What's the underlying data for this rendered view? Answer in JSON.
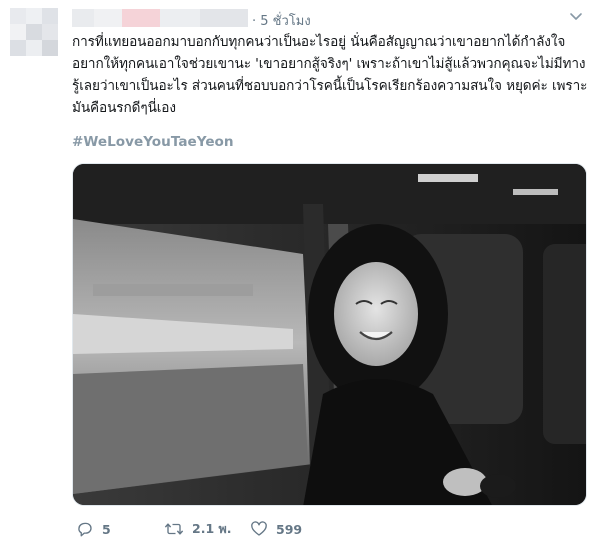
{
  "tweet": {
    "timestamp": "· 5 ชั่วโมง",
    "text_lines": [
      "การที่แทยอนออกมาบอกกับทุกคนว่าเป็นอะไรอยู่ นั่นคือสัญญาณว่าเขาอยากได้กำลังใจ",
      "อยากให้ทุกคนเอาใจช่วยเขานะ 'เขาอยากสู้จริงๆ' เพราะถ้าเขาไม่สู้แล้วพวกคุณจะไม่มีทาง",
      "รู้เลยว่าเขาเป็นอะไร ส่วนคนที่ชอบบอกว่าโรคนี้เป็นโรคเรียกร้องความสนใจ หยุดค่ะ เพราะ",
      "มันคือนรกดีๆนี่เอง"
    ],
    "hashtag": "#WeLoveYouTaeYeon",
    "replies": "5",
    "retweets": "2.1 พ.",
    "likes": "599"
  },
  "icons": {
    "reply": "reply-icon",
    "retweet": "retweet-icon",
    "like": "heart-icon",
    "menu": "chevron-down-icon"
  },
  "colors": {
    "text": "#14171a",
    "secondary": "#657786",
    "hashtag": "#8899a6"
  }
}
